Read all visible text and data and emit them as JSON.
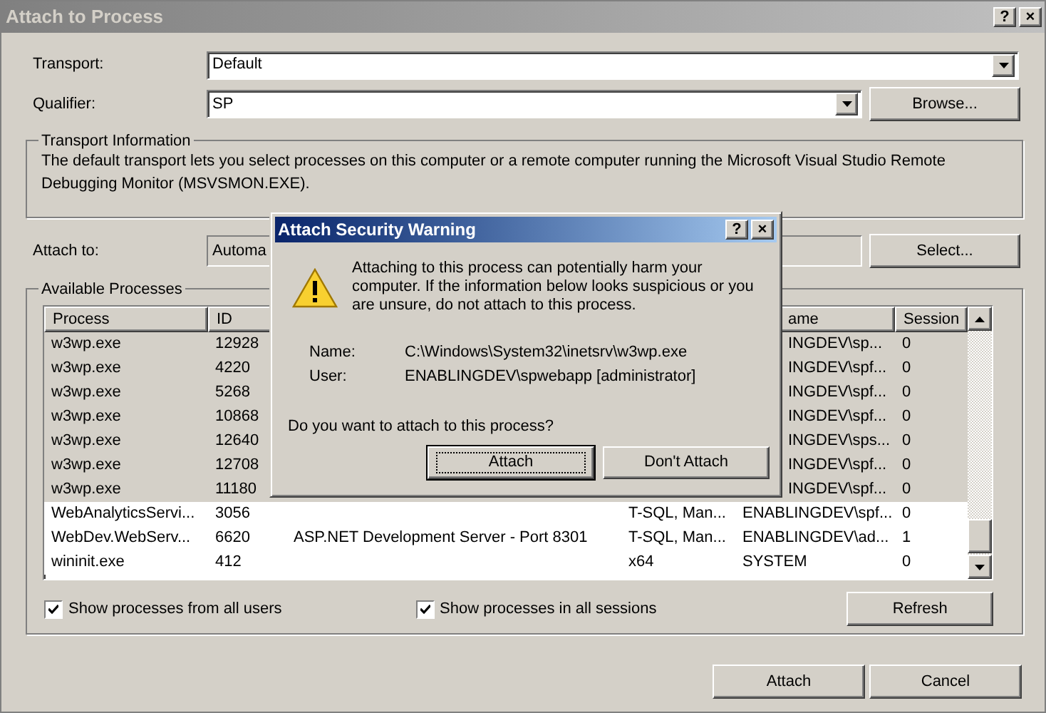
{
  "window": {
    "title": "Attach to Process",
    "buttons": [
      "?",
      "×"
    ]
  },
  "transport": {
    "label": "Transport:",
    "value": "Default"
  },
  "qualifier": {
    "label": "Qualifier:",
    "value": "SP",
    "button": "Browse..."
  },
  "transport_information": {
    "title": "Transport Information",
    "text": "The default transport lets you select processes on this computer or a remote computer running the Microsoft Visual Studio Remote Debugging Monitor (MSVSMON.EXE)."
  },
  "attach_to": {
    "label": "Attach to:",
    "value": "Automa",
    "button": "Select..."
  },
  "available_processes": {
    "title": "Available Processes",
    "columns": [
      "Process",
      "ID",
      "ame",
      "Session"
    ],
    "rows": [
      {
        "process": "w3wp.exe",
        "id": "12928",
        "user_name": "INGDEV\\sp...",
        "session": "0",
        "selected": true
      },
      {
        "process": "w3wp.exe",
        "id": "4220",
        "user_name": "INGDEV\\spf...",
        "session": "0",
        "selected": true
      },
      {
        "process": "w3wp.exe",
        "id": "5268",
        "user_name": "INGDEV\\spf...",
        "session": "0",
        "selected": true
      },
      {
        "process": "w3wp.exe",
        "id": "10868",
        "user_name": "INGDEV\\spf...",
        "session": "0",
        "selected": true
      },
      {
        "process": "w3wp.exe",
        "id": "12640",
        "user_name": "INGDEV\\sps...",
        "session": "0",
        "selected": true
      },
      {
        "process": "w3wp.exe",
        "id": "12708",
        "user_name": "INGDEV\\spf...",
        "session": "0",
        "selected": true
      },
      {
        "process": "w3wp.exe",
        "id": "11180",
        "user_name": "INGDEV\\spf...",
        "session": "0",
        "selected": true
      },
      {
        "process": "WebAnalyticsServi...",
        "id": "3056",
        "type": "T-SQL, Man...",
        "user_name": "ENABLINGDEV\\spf...",
        "session": "0",
        "selected": false
      },
      {
        "process": "WebDev.WebServ...",
        "id": "6620",
        "title": "ASP.NET Development Server - Port 8301",
        "type": "T-SQL, Man...",
        "user_name": "ENABLINGDEV\\ad...",
        "session": "1",
        "selected": false
      },
      {
        "process": "wininit.exe",
        "id": "412",
        "type": "x64",
        "user_name": "SYSTEM",
        "session": "0",
        "selected": false
      }
    ],
    "options": [
      {
        "label": "Show processes from all users",
        "checked": true
      },
      {
        "label": "Show processes in all sessions",
        "checked": true
      }
    ],
    "refresh_button": "Refresh"
  },
  "buttons": [
    "Attach",
    "Cancel"
  ],
  "security_warning": {
    "title": "Attach Security Warning",
    "buttons": [
      "?",
      "×"
    ],
    "message": "Attaching to this process can potentially harm your computer. If the information below looks suspicious or you are unsure, do not attach to this process.",
    "details": [
      {
        "label": "Name:",
        "value": "C:\\Windows\\System32\\inetsrv\\w3wp.exe"
      },
      {
        "label": "User:",
        "value": "ENABLINGDEV\\spwebapp [administrator]"
      }
    ],
    "question": "Do you want to attach to this process?",
    "actions": [
      {
        "label": "Attach",
        "focused": true
      },
      {
        "label": "Don't Attach",
        "focused": false
      }
    ]
  }
}
